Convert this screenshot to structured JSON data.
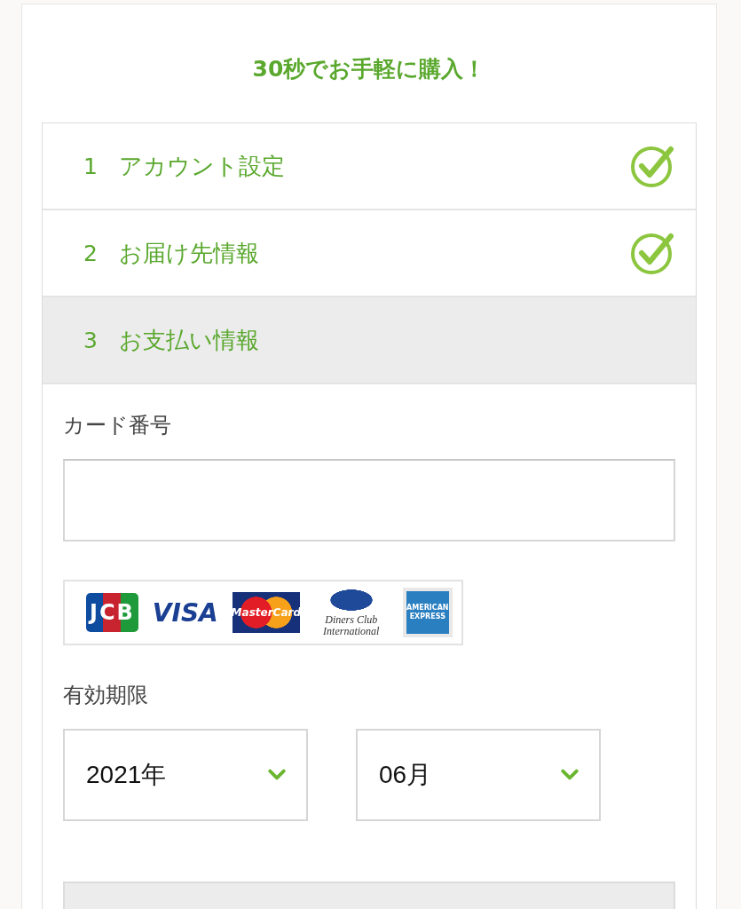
{
  "title": "30秒でお手軽に購入！",
  "steps": [
    {
      "number": "1",
      "label": "アカウント設定",
      "completed": true,
      "selected": false
    },
    {
      "number": "2",
      "label": "お届け先情報",
      "completed": true,
      "selected": false
    },
    {
      "number": "3",
      "label": "お支払い情報",
      "completed": false,
      "selected": true
    }
  ],
  "card_number": {
    "label": "カード番号"
  },
  "card_brands": [
    {
      "kind": "jcb",
      "text": "JCB"
    },
    {
      "kind": "visa",
      "text": "VISA"
    },
    {
      "kind": "mastercard",
      "text": "MasterCard"
    },
    {
      "kind": "diners",
      "text": "Diners Club International"
    },
    {
      "kind": "amex",
      "text": "AMERICAN EXPRESS"
    }
  ],
  "expiry": {
    "label": "有効期限",
    "year": "2021年",
    "month": "06月"
  }
}
